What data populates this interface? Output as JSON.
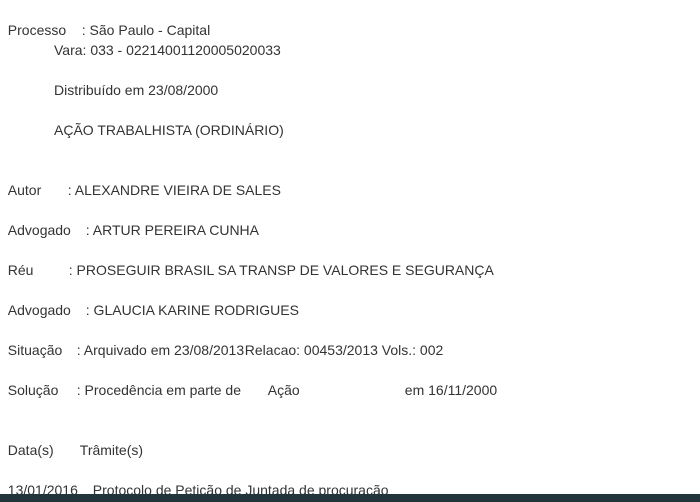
{
  "processo": {
    "label": "Processo",
    "value": ": São Paulo - Capital",
    "vara": "Vara: 033 - 02214001120005020033",
    "distribuido": "Distribuído em 23/08/2000",
    "acao": "AÇÃO TRABALHISTA (ORDINÁRIO)"
  },
  "autor": {
    "label": "Autor",
    "value": ": ALEXANDRE VIEIRA DE SALES"
  },
  "advogado_autor": {
    "label": "Advogado",
    "value": ": ARTUR PEREIRA CUNHA"
  },
  "reu": {
    "label": "Réu",
    "value": ": PROSEGUIR BRASIL SA TRANSP DE VALORES E SEGURANÇA"
  },
  "advogado_reu": {
    "label": "Advogado",
    "value": ": GLAUCIA KARINE RODRIGUES"
  },
  "situacao": {
    "label": "Situação",
    "value": ": Arquivado em 23/08/2013",
    "relacao": "Relacao: 00453/2013 Vols.: 002"
  },
  "solucao": {
    "label": "Solução",
    "value": ": Procedência em parte de",
    "acao": "Ação",
    "data": "em 16/11/2000"
  },
  "tramites": {
    "headers": [
      "Data(s)",
      "Trâmite(s)"
    ],
    "rows": [
      {
        "date": "13/01/2016",
        "text": "Protocolo de Petição de Juntada de procuração"
      }
    ]
  },
  "colors": {
    "text": "#333333",
    "bottom_bar": "#24343b"
  }
}
